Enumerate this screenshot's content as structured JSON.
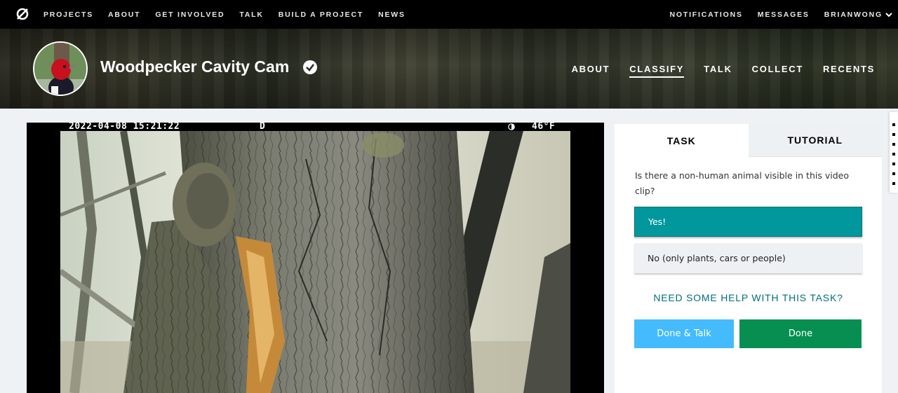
{
  "topnav": {
    "logo_icon": "zooniverse-logo-icon",
    "links": [
      "PROJECTS",
      "ABOUT",
      "GET INVOLVED",
      "TALK",
      "BUILD A PROJECT",
      "NEWS"
    ],
    "notifications": "NOTIFICATIONS",
    "messages": "MESSAGES",
    "username": "BRIANWONG"
  },
  "project": {
    "title": "Woodpecker Cavity Cam",
    "verified_icon": "verified-check-icon",
    "nav": [
      "ABOUT",
      "CLASSIFY",
      "TALK",
      "COLLECT",
      "RECENTS"
    ],
    "active_nav": "CLASSIFY"
  },
  "viewer": {
    "timestamp": "2022-04-08 15:21:22",
    "mode": "D",
    "moon_icon": "moon-phase-icon",
    "temperature": "46°F"
  },
  "classifier": {
    "tab_task": "TASK",
    "tab_tutorial": "TUTORIAL",
    "question": "Is there a non-human animal visible in this video clip?",
    "answers": [
      "Yes!",
      "No (only plants, cars or people)"
    ],
    "selected_answer": 0,
    "help_link": "NEED SOME HELP WITH THIS TASK?",
    "done_talk": "Done & Talk",
    "done": "Done"
  },
  "colors": {
    "selected_answer": "#00979d",
    "done_talk": "#43bbfd",
    "done": "#078f52",
    "help_link": "#00707a"
  }
}
